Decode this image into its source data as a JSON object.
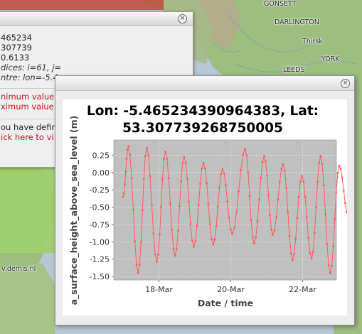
{
  "map": {
    "places": [
      {
        "name": "GONSETT"
      },
      {
        "name": "DARLINGTON"
      },
      {
        "name": "Thirsk"
      },
      {
        "name": "YORK"
      },
      {
        "name": "LEEDS"
      }
    ],
    "credit": "v.demis.nl",
    "colors": {
      "sea": "#b6c8d6",
      "land": "#9bbf7b",
      "hills": "#b7a88d"
    }
  },
  "back_panel": {
    "lines": [
      "465234",
      "307739",
      "0.6133"
    ],
    "indices": "dices: i=61, j=",
    "centre": "ntre: lon=-5.4",
    "min_value": "nimum value e",
    "max_value": "ximum value",
    "defined": "ou have defin",
    "click_here": "ick here to vi"
  },
  "popup": {
    "close_symbol": "×",
    "title_line1": "Lon: -5.465234390964383, Lat:",
    "title_line2": "53.307739268750005",
    "ylabel": "a_surface_height_above_sea_level (m)",
    "xlabel": "Date / time"
  },
  "chart_data": {
    "type": "line",
    "title": "Lon: -5.465234390964383, Lat: 53.307739268750005",
    "xlabel": "Date / time",
    "ylabel": "a_surface_height_above_sea_level (m)",
    "x_ticks": [
      "18-Mar",
      "20-Mar",
      "22-Mar"
    ],
    "y_ticks": [
      0.25,
      0.0,
      -0.25,
      -0.5,
      -0.75,
      -1.0,
      -1.25,
      -1.5
    ],
    "xlim": [
      0.0,
      6.4
    ],
    "ylim": [
      -1.55,
      0.47
    ],
    "grid": true,
    "colors": {
      "line": "#ff5a5a",
      "plot_bg": "#c0c0c0",
      "grid": "#e6e6e6"
    },
    "series": [
      {
        "peaks": [
          [
            0.15,
            0.38
          ],
          [
            0.66,
            0.36
          ],
          [
            1.18,
            0.3
          ],
          [
            1.7,
            0.23
          ],
          [
            2.24,
            0.14
          ],
          [
            2.77,
            0.05
          ],
          [
            3.4,
            0.34
          ],
          [
            3.93,
            0.24
          ],
          [
            4.46,
            0.12
          ],
          [
            4.98,
            -0.05
          ],
          [
            5.5,
            0.24
          ],
          [
            6.02,
            0.1
          ]
        ],
        "troughs": [
          [
            0.0,
            -0.35
          ],
          [
            0.42,
            -1.45
          ],
          [
            0.94,
            -1.29
          ],
          [
            1.45,
            -1.2
          ],
          [
            1.97,
            -1.07
          ],
          [
            2.51,
            -1.04
          ],
          [
            3.04,
            -0.88
          ],
          [
            3.65,
            -1.02
          ],
          [
            4.17,
            -0.9
          ],
          [
            4.72,
            -1.26
          ],
          [
            5.25,
            -1.24
          ],
          [
            5.77,
            -1.45
          ],
          [
            6.27,
            -0.62
          ]
        ]
      }
    ]
  }
}
